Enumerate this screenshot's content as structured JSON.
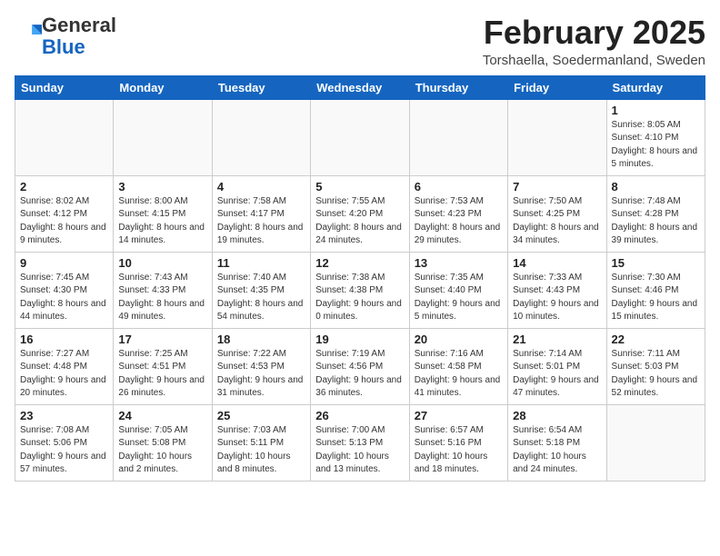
{
  "header": {
    "logo_general": "General",
    "logo_blue": "Blue",
    "month_title": "February 2025",
    "location": "Torshaella, Soedermanland, Sweden"
  },
  "weekdays": [
    "Sunday",
    "Monday",
    "Tuesday",
    "Wednesday",
    "Thursday",
    "Friday",
    "Saturday"
  ],
  "weeks": [
    [
      {
        "day": "",
        "info": ""
      },
      {
        "day": "",
        "info": ""
      },
      {
        "day": "",
        "info": ""
      },
      {
        "day": "",
        "info": ""
      },
      {
        "day": "",
        "info": ""
      },
      {
        "day": "",
        "info": ""
      },
      {
        "day": "1",
        "info": "Sunrise: 8:05 AM\nSunset: 4:10 PM\nDaylight: 8 hours and 5 minutes."
      }
    ],
    [
      {
        "day": "2",
        "info": "Sunrise: 8:02 AM\nSunset: 4:12 PM\nDaylight: 8 hours and 9 minutes."
      },
      {
        "day": "3",
        "info": "Sunrise: 8:00 AM\nSunset: 4:15 PM\nDaylight: 8 hours and 14 minutes."
      },
      {
        "day": "4",
        "info": "Sunrise: 7:58 AM\nSunset: 4:17 PM\nDaylight: 8 hours and 19 minutes."
      },
      {
        "day": "5",
        "info": "Sunrise: 7:55 AM\nSunset: 4:20 PM\nDaylight: 8 hours and 24 minutes."
      },
      {
        "day": "6",
        "info": "Sunrise: 7:53 AM\nSunset: 4:23 PM\nDaylight: 8 hours and 29 minutes."
      },
      {
        "day": "7",
        "info": "Sunrise: 7:50 AM\nSunset: 4:25 PM\nDaylight: 8 hours and 34 minutes."
      },
      {
        "day": "8",
        "info": "Sunrise: 7:48 AM\nSunset: 4:28 PM\nDaylight: 8 hours and 39 minutes."
      }
    ],
    [
      {
        "day": "9",
        "info": "Sunrise: 7:45 AM\nSunset: 4:30 PM\nDaylight: 8 hours and 44 minutes."
      },
      {
        "day": "10",
        "info": "Sunrise: 7:43 AM\nSunset: 4:33 PM\nDaylight: 8 hours and 49 minutes."
      },
      {
        "day": "11",
        "info": "Sunrise: 7:40 AM\nSunset: 4:35 PM\nDaylight: 8 hours and 54 minutes."
      },
      {
        "day": "12",
        "info": "Sunrise: 7:38 AM\nSunset: 4:38 PM\nDaylight: 9 hours and 0 minutes."
      },
      {
        "day": "13",
        "info": "Sunrise: 7:35 AM\nSunset: 4:40 PM\nDaylight: 9 hours and 5 minutes."
      },
      {
        "day": "14",
        "info": "Sunrise: 7:33 AM\nSunset: 4:43 PM\nDaylight: 9 hours and 10 minutes."
      },
      {
        "day": "15",
        "info": "Sunrise: 7:30 AM\nSunset: 4:46 PM\nDaylight: 9 hours and 15 minutes."
      }
    ],
    [
      {
        "day": "16",
        "info": "Sunrise: 7:27 AM\nSunset: 4:48 PM\nDaylight: 9 hours and 20 minutes."
      },
      {
        "day": "17",
        "info": "Sunrise: 7:25 AM\nSunset: 4:51 PM\nDaylight: 9 hours and 26 minutes."
      },
      {
        "day": "18",
        "info": "Sunrise: 7:22 AM\nSunset: 4:53 PM\nDaylight: 9 hours and 31 minutes."
      },
      {
        "day": "19",
        "info": "Sunrise: 7:19 AM\nSunset: 4:56 PM\nDaylight: 9 hours and 36 minutes."
      },
      {
        "day": "20",
        "info": "Sunrise: 7:16 AM\nSunset: 4:58 PM\nDaylight: 9 hours and 41 minutes."
      },
      {
        "day": "21",
        "info": "Sunrise: 7:14 AM\nSunset: 5:01 PM\nDaylight: 9 hours and 47 minutes."
      },
      {
        "day": "22",
        "info": "Sunrise: 7:11 AM\nSunset: 5:03 PM\nDaylight: 9 hours and 52 minutes."
      }
    ],
    [
      {
        "day": "23",
        "info": "Sunrise: 7:08 AM\nSunset: 5:06 PM\nDaylight: 9 hours and 57 minutes."
      },
      {
        "day": "24",
        "info": "Sunrise: 7:05 AM\nSunset: 5:08 PM\nDaylight: 10 hours and 2 minutes."
      },
      {
        "day": "25",
        "info": "Sunrise: 7:03 AM\nSunset: 5:11 PM\nDaylight: 10 hours and 8 minutes."
      },
      {
        "day": "26",
        "info": "Sunrise: 7:00 AM\nSunset: 5:13 PM\nDaylight: 10 hours and 13 minutes."
      },
      {
        "day": "27",
        "info": "Sunrise: 6:57 AM\nSunset: 5:16 PM\nDaylight: 10 hours and 18 minutes."
      },
      {
        "day": "28",
        "info": "Sunrise: 6:54 AM\nSunset: 5:18 PM\nDaylight: 10 hours and 24 minutes."
      },
      {
        "day": "",
        "info": ""
      }
    ]
  ]
}
